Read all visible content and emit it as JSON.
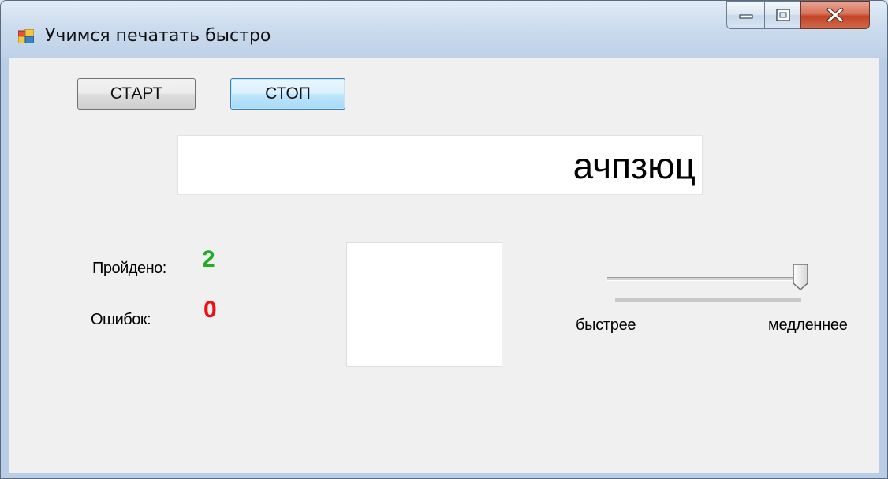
{
  "window": {
    "title": "Учимся печатать быстро",
    "icon": "winforms-app-icon",
    "caption_buttons": [
      "minimize-icon",
      "maximize-icon",
      "close-icon"
    ]
  },
  "toolbar": {
    "start_label": "СТАРТ",
    "stop_label": "СТОП"
  },
  "display": {
    "word": "ачпзюц"
  },
  "stats": {
    "passed_label": "Пройдено:",
    "passed_value": "2",
    "errors_label": "Ошибок:",
    "errors_value": "0"
  },
  "speed": {
    "faster_label": "быстрее",
    "slower_label": "медленнее",
    "level": 1.0
  },
  "colors": {
    "passed": "#1fae24",
    "errors": "#ee1111",
    "close_button": "#c34326"
  }
}
